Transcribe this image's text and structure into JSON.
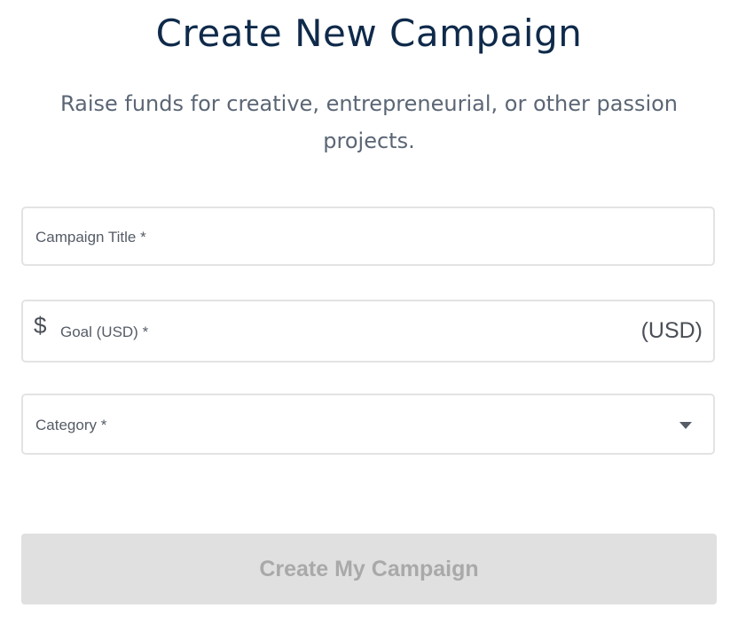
{
  "page": {
    "title": "Create New Campaign",
    "subtitle": "Raise funds for creative, entrepreneurial, or other passion projects."
  },
  "form": {
    "campaign_title": {
      "label": "Campaign Title *",
      "value": ""
    },
    "goal": {
      "currency_symbol": "$",
      "label": "Goal (USD) *",
      "suffix": "(USD)",
      "value": ""
    },
    "category": {
      "label": "Category *",
      "icon": "chevron-down-icon",
      "selected": ""
    },
    "submit_label": "Create My Campaign",
    "submit_enabled": false
  },
  "colors": {
    "heading": "#0f2a4a",
    "subtitle": "#5b6675",
    "field_border": "#e3e3e3",
    "button_disabled_bg": "#e0e0e0",
    "button_disabled_text": "#a9a9a9"
  }
}
